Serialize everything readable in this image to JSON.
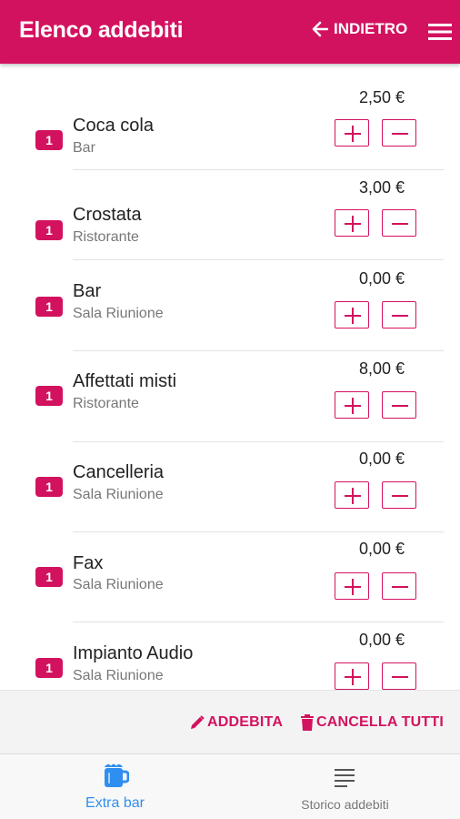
{
  "header": {
    "title": "Elenco addebiti",
    "back_label": "INDIETRO",
    "accent_color": "#d3125f"
  },
  "items": [
    {
      "qty": "1",
      "name": "Coca cola",
      "category": "Bar",
      "price": "2,50 €"
    },
    {
      "qty": "1",
      "name": "Crostata",
      "category": "Ristorante",
      "price": "3,00 €"
    },
    {
      "qty": "1",
      "name": "Bar",
      "category": "Sala Riunione",
      "price": "0,00 €"
    },
    {
      "qty": "1",
      "name": "Affettati misti",
      "category": "Ristorante",
      "price": "8,00 €"
    },
    {
      "qty": "1",
      "name": "Cancelleria",
      "category": "Sala Riunione",
      "price": "0,00 €"
    },
    {
      "qty": "1",
      "name": "Fax",
      "category": "Sala Riunione",
      "price": "0,00 €"
    },
    {
      "qty": "1",
      "name": "Impianto Audio",
      "category": "Sala Riunione",
      "price": "0,00 €"
    }
  ],
  "actions": {
    "charge_label": "ADDEBITA",
    "clear_label": "CANCELLA TUTTI"
  },
  "bottom_nav": {
    "items": [
      {
        "label": "Extra bar",
        "icon": "coffee-mug-icon",
        "active": true
      },
      {
        "label": "Storico addebiti",
        "icon": "list-lines-icon",
        "active": false
      }
    ],
    "active_color": "#2f8ff0"
  }
}
